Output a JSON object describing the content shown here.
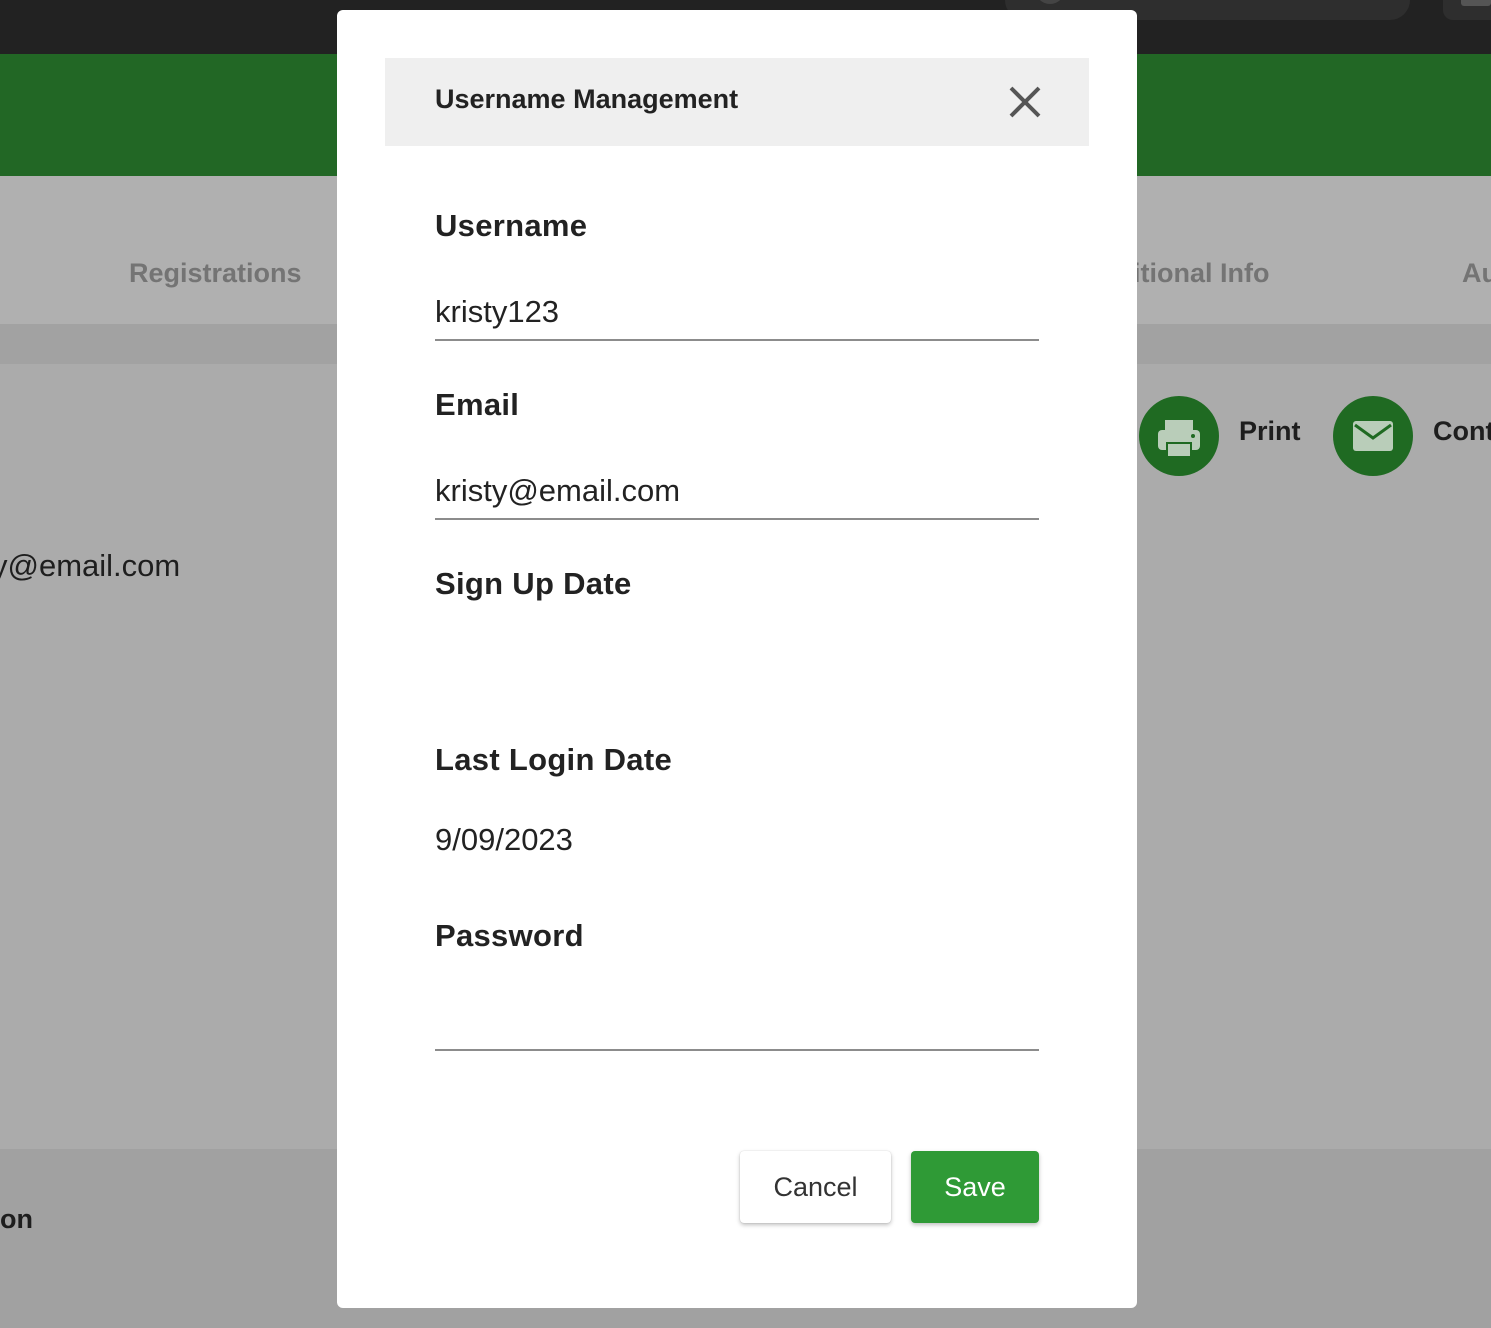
{
  "background": {
    "tabs": [
      {
        "label": "Registrations"
      },
      {
        "label": "itional Info"
      },
      {
        "label": "Au"
      }
    ],
    "email_partial": "y@email.com",
    "footer_partial": "on",
    "actions": [
      {
        "label": "Print",
        "icon": "printer-icon"
      },
      {
        "label": "Cont",
        "icon": "mail-icon"
      }
    ]
  },
  "modal": {
    "title": "Username Management",
    "close_icon": "close-icon",
    "fields": {
      "username": {
        "label": "Username",
        "value": "kristy123"
      },
      "email": {
        "label": "Email",
        "value": "kristy@email.com"
      },
      "signup_date": {
        "label": "Sign Up Date",
        "value": ""
      },
      "last_login": {
        "label": "Last Login Date",
        "value": "9/09/2023"
      },
      "password": {
        "label": "Password",
        "value": ""
      }
    },
    "buttons": {
      "cancel": "Cancel",
      "save": "Save"
    }
  },
  "colors": {
    "brand_green": "#226725",
    "save_green": "#2f9a36",
    "icon_green": "#1f6a22"
  }
}
